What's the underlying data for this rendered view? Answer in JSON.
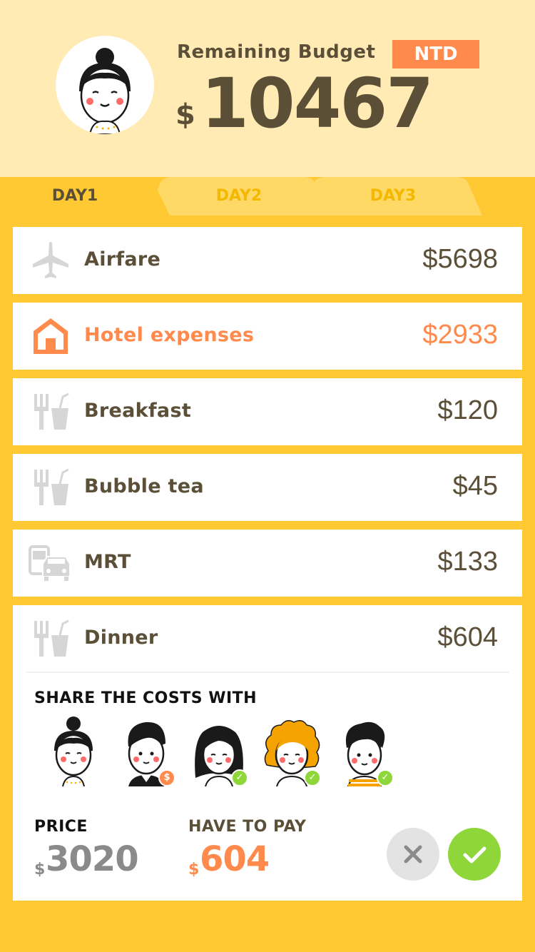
{
  "header": {
    "budget_label": "Remaining Budget",
    "currency": "NTD",
    "dollar_sign": "$",
    "remaining": "10467"
  },
  "tabs": [
    {
      "label": "DAY1",
      "active": true
    },
    {
      "label": "DAY2",
      "active": false
    },
    {
      "label": "DAY3",
      "active": false
    }
  ],
  "expenses": [
    {
      "icon": "airplane-icon",
      "label": "Airfare",
      "amount": "$5698"
    },
    {
      "icon": "house-icon",
      "label": "Hotel expenses",
      "amount": "$2933",
      "highlighted": true
    },
    {
      "icon": "food-drink-icon",
      "label": "Breakfast",
      "amount": "$120"
    },
    {
      "icon": "food-drink-icon",
      "label": "Bubble tea",
      "amount": "$45"
    },
    {
      "icon": "transport-icon",
      "label": "MRT",
      "amount": "$133"
    },
    {
      "icon": "food-drink-icon",
      "label": "Dinner",
      "amount": "$604"
    }
  ],
  "share": {
    "title": "SHARE THE COSTS WITH",
    "people": [
      {
        "name": "avatar-bun-woman",
        "badge": ""
      },
      {
        "name": "avatar-man-quiff",
        "badge": "$",
        "badge_color": "#FF8A4C"
      },
      {
        "name": "avatar-long-hair-woman",
        "badge": "✓",
        "badge_color": "#8ED63A"
      },
      {
        "name": "avatar-curly-hair-woman",
        "badge": "✓",
        "badge_color": "#8ED63A"
      },
      {
        "name": "avatar-man-striped",
        "badge": "✓",
        "badge_color": "#8ED63A"
      }
    ]
  },
  "price": {
    "label": "PRICE",
    "dollar": "$",
    "value": "3020"
  },
  "pay": {
    "label": "HAVE TO PAY",
    "dollar": "$",
    "value": "604"
  },
  "colors": {
    "accent": "#FF8A4C",
    "background": "#FFC933",
    "header_bg": "#FFEBB3",
    "text": "#5B4F38",
    "confirm": "#8ED63A",
    "cancel": "#E3E3E3",
    "price_grey": "#8A8A8A"
  }
}
